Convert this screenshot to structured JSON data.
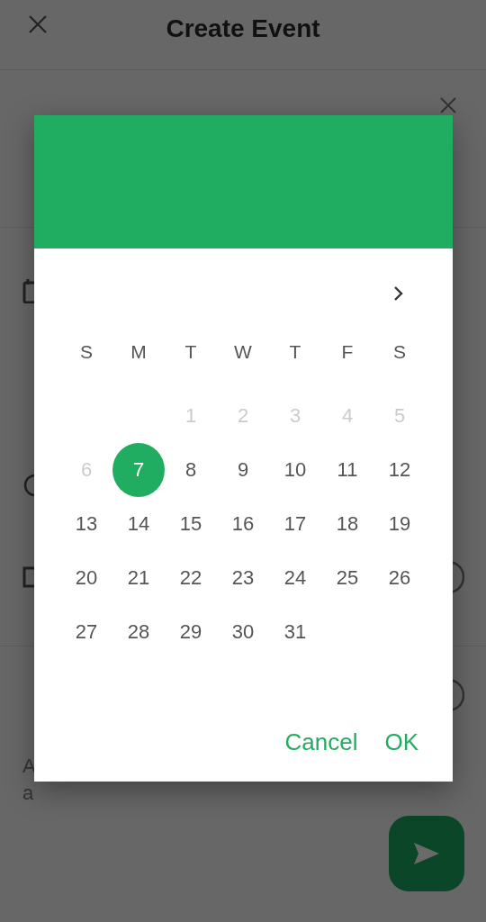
{
  "app_bar": {
    "title": "Create Event"
  },
  "background": {
    "description_fragments": [
      "A",
      "a"
    ]
  },
  "date_picker": {
    "weekdays": [
      "S",
      "M",
      "T",
      "W",
      "T",
      "F",
      "S"
    ],
    "weeks": [
      [
        {
          "day": "1",
          "disabled": true,
          "selected": false
        },
        {
          "day": "2",
          "disabled": true,
          "selected": false
        },
        {
          "day": "3",
          "disabled": true,
          "selected": false
        },
        {
          "day": "4",
          "disabled": true,
          "selected": false
        },
        {
          "day": "5",
          "disabled": true,
          "selected": false
        }
      ],
      [
        {
          "day": "6",
          "disabled": true,
          "selected": false
        },
        {
          "day": "7",
          "disabled": false,
          "selected": true
        },
        {
          "day": "8",
          "disabled": false,
          "selected": false
        },
        {
          "day": "9",
          "disabled": false,
          "selected": false
        },
        {
          "day": "10",
          "disabled": false,
          "selected": false
        },
        {
          "day": "11",
          "disabled": false,
          "selected": false
        },
        {
          "day": "12",
          "disabled": false,
          "selected": false
        }
      ],
      [
        {
          "day": "13",
          "disabled": false,
          "selected": false
        },
        {
          "day": "14",
          "disabled": false,
          "selected": false
        },
        {
          "day": "15",
          "disabled": false,
          "selected": false
        },
        {
          "day": "16",
          "disabled": false,
          "selected": false
        },
        {
          "day": "17",
          "disabled": false,
          "selected": false
        },
        {
          "day": "18",
          "disabled": false,
          "selected": false
        },
        {
          "day": "19",
          "disabled": false,
          "selected": false
        }
      ],
      [
        {
          "day": "20",
          "disabled": false,
          "selected": false
        },
        {
          "day": "21",
          "disabled": false,
          "selected": false
        },
        {
          "day": "22",
          "disabled": false,
          "selected": false
        },
        {
          "day": "23",
          "disabled": false,
          "selected": false
        },
        {
          "day": "24",
          "disabled": false,
          "selected": false
        },
        {
          "day": "25",
          "disabled": false,
          "selected": false
        },
        {
          "day": "26",
          "disabled": false,
          "selected": false
        }
      ],
      [
        {
          "day": "27",
          "disabled": false,
          "selected": false
        },
        {
          "day": "28",
          "disabled": false,
          "selected": false
        },
        {
          "day": "29",
          "disabled": false,
          "selected": false
        },
        {
          "day": "30",
          "disabled": false,
          "selected": false
        },
        {
          "day": "31",
          "disabled": false,
          "selected": false
        }
      ]
    ],
    "buttons": [
      "Cancel",
      "OK"
    ]
  }
}
